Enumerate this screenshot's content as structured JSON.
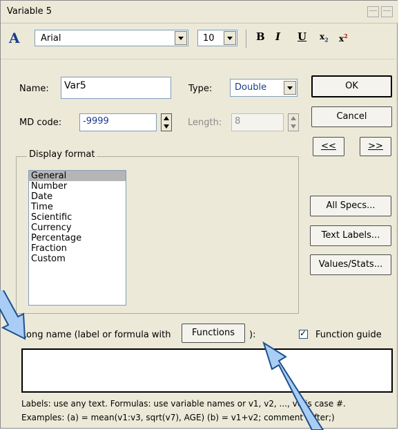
{
  "window": {
    "title": "Variable 5"
  },
  "toolbar": {
    "font_name": "Arial",
    "font_size": "10",
    "bold_label": "B",
    "italic_label": "I",
    "underline_label": "U",
    "subscript_label": "x",
    "superscript_label": "x"
  },
  "fields": {
    "name_label": "Name:",
    "name_value": "Var5",
    "type_label": "Type:",
    "type_value": "Double",
    "md_code_label": "MD code:",
    "md_code_value": "-9999",
    "length_label": "Length:",
    "length_value": "8"
  },
  "buttons": {
    "ok": "OK",
    "cancel": "Cancel",
    "prev": "<<",
    "next": ">>",
    "all_specs": "All Specs...",
    "text_labels": "Text Labels...",
    "values_stats": "Values/Stats...",
    "functions": "Functions"
  },
  "display_format": {
    "title": "Display format",
    "items": [
      "General",
      "Number",
      "Date",
      "Time",
      "Scientific",
      "Currency",
      "Percentage",
      "Fraction",
      "Custom"
    ],
    "selected": "General"
  },
  "long_name": {
    "label": "Long name (label or formula with",
    "label_close": "):",
    "value": ""
  },
  "function_guide": {
    "label": "Function guide",
    "checked": true
  },
  "hints": {
    "line1": "Labels: use any text.  Formulas: use variable names or v1, v2, ..., v0 is case #.",
    "line2": "Examples:  (a) = mean(v1:v3, sqrt(v7), AGE)  (b) = v1+v2; comment (after;)"
  },
  "colors": {
    "dialog_bg": "#ece9d8",
    "arrow_fill": "#a9cdf5",
    "arrow_stroke": "#1c4f8c"
  }
}
